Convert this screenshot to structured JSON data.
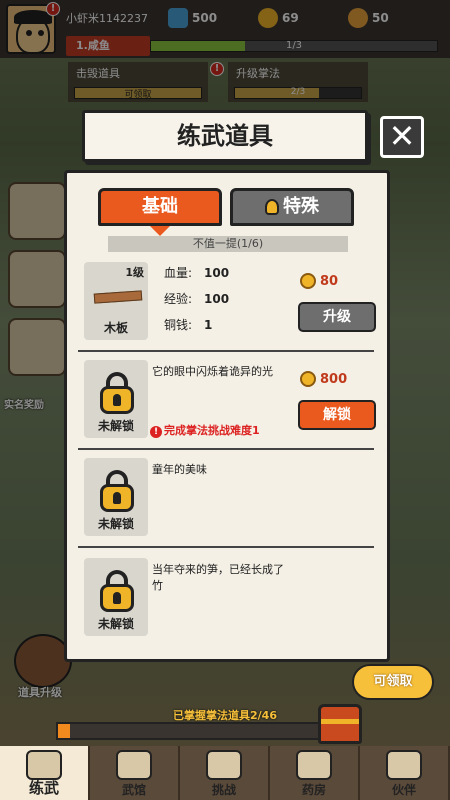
{
  "hud": {
    "username": "小虾米1142237",
    "gems": "500",
    "coins": "69",
    "currency3": "50",
    "level_badge": "1.咸鱼",
    "level_progress_text": "1/3",
    "level_progress": 0.33
  },
  "quests": [
    {
      "name": "击毁道具",
      "action": "可领取"
    },
    {
      "name": "升级掌法",
      "progress_text": "2/3",
      "progress": 0.67
    }
  ],
  "side": {
    "realname_label": "实名奖励"
  },
  "dialog": {
    "title": "练武道具",
    "close_glyph": "✕",
    "tabs": {
      "basic": "基础",
      "special": "特殊"
    },
    "category": "不值一提(1/6)",
    "items": [
      {
        "level": "1级",
        "name": "木板",
        "stats": [
          {
            "k": "血量:",
            "v": "100"
          },
          {
            "k": "经验:",
            "v": "100"
          },
          {
            "k": "铜钱:",
            "v": "1"
          }
        ],
        "cost": "80",
        "button": "升级"
      },
      {
        "name": "未解锁",
        "desc": "它的眼中闪烁着诡异的光",
        "cost": "800",
        "button": "解锁",
        "requirement": "完成掌法挑战难度1",
        "req_mark": "!"
      },
      {
        "name": "未解锁",
        "desc": "童年的美味"
      },
      {
        "name": "未解锁",
        "desc": "当年夺来的笋，已经长成了竹"
      }
    ]
  },
  "bottom": {
    "claim": "可领取",
    "progress_label": "已掌握掌法道具2/46",
    "progress": 0.043,
    "tool_upgrade": "道具升级"
  },
  "nav": [
    {
      "label": "练武",
      "active": true
    },
    {
      "label": "武馆"
    },
    {
      "label": "挑战"
    },
    {
      "label": "药房"
    },
    {
      "label": "伙伴"
    }
  ],
  "colors": {
    "accent": "#ea5a1e",
    "panel": "#f4f0e6",
    "coin": "#f0b429",
    "warn": "#dd2222"
  }
}
